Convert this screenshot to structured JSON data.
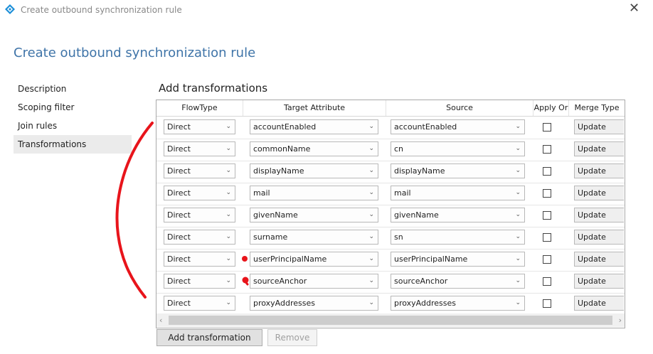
{
  "window": {
    "title": "Create outbound synchronization rule"
  },
  "page": {
    "title": "Create outbound synchronization rule"
  },
  "nav": {
    "items": [
      {
        "label": "Description",
        "selected": false
      },
      {
        "label": "Scoping filter",
        "selected": false
      },
      {
        "label": "Join rules",
        "selected": false
      },
      {
        "label": "Transformations",
        "selected": true
      }
    ]
  },
  "section": {
    "title": "Add transformations"
  },
  "grid": {
    "headers": {
      "flowtype": "FlowType",
      "target": "Target Attribute",
      "source": "Source",
      "apply_once": "Apply Or",
      "merge_type": "Merge Type"
    },
    "rows": [
      {
        "flowtype": "Direct",
        "target": "accountEnabled",
        "source": "accountEnabled",
        "apply_once": false,
        "merge_type": "Update"
      },
      {
        "flowtype": "Direct",
        "target": "commonName",
        "source": "cn",
        "apply_once": false,
        "merge_type": "Update"
      },
      {
        "flowtype": "Direct",
        "target": "displayName",
        "source": "displayName",
        "apply_once": false,
        "merge_type": "Update"
      },
      {
        "flowtype": "Direct",
        "target": "mail",
        "source": "mail",
        "apply_once": false,
        "merge_type": "Update"
      },
      {
        "flowtype": "Direct",
        "target": "givenName",
        "source": "givenName",
        "apply_once": false,
        "merge_type": "Update"
      },
      {
        "flowtype": "Direct",
        "target": "surname",
        "source": "sn",
        "apply_once": false,
        "merge_type": "Update"
      },
      {
        "flowtype": "Direct",
        "target": "userPrincipalName",
        "source": "userPrincipalName",
        "apply_once": false,
        "merge_type": "Update"
      },
      {
        "flowtype": "Direct",
        "target": "sourceAnchor",
        "source": "sourceAnchor",
        "apply_once": false,
        "merge_type": "Update"
      },
      {
        "flowtype": "Direct",
        "target": "proxyAddresses",
        "source": "proxyAddresses",
        "apply_once": false,
        "merge_type": "Update"
      }
    ]
  },
  "buttons": {
    "add": "Add transformation",
    "remove": "Remove"
  },
  "colors": {
    "title_blue": "#3f74a8",
    "annotation_red": "#e8141b",
    "selected_nav": "#ebebeb"
  },
  "icons": {
    "app": "diamond-app-icon",
    "close": "close-icon",
    "combo": "chevron-down-icon"
  }
}
